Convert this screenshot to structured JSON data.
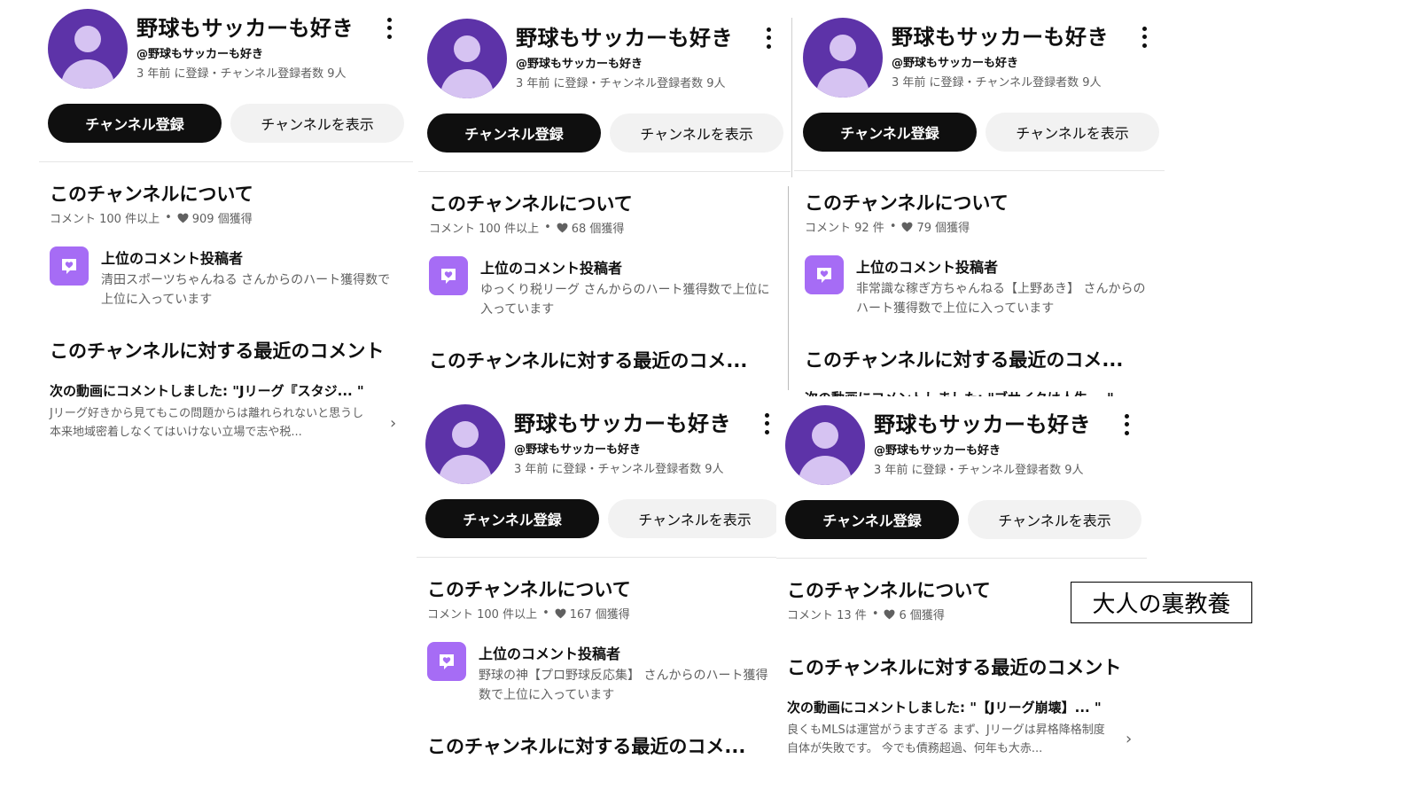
{
  "shared": {
    "channel_name": "野球もサッカーも好き",
    "handle": "@野球もサッカーも好き",
    "meta": "3 年前 に登録・チャンネル登録者数 9人",
    "subscribe_label": "チャンネル登録",
    "view_label": "チャンネルを表示",
    "about_title": "このチャンネルについて",
    "top_commenter_title": "上位のコメント投稿者",
    "recent_title": "このチャンネルに対する最近のコメント",
    "recent_title_truncated": "このチャンネルに対する最近のコメ...",
    "colors": {
      "avatar_bg": "#5d33a8",
      "avatar_figure": "#d6c3f2",
      "badge": "#a66cf5",
      "subscribe_bg": "#0f0f0f",
      "view_bg": "#f2f2f2"
    },
    "icons": [
      "more-vert-icon",
      "heart-icon",
      "comment-heart-icon",
      "chevron-right-icon",
      "avatar-icon"
    ]
  },
  "panels": [
    {
      "comments_count": "コメント 100 件以上",
      "hearts": "909 個獲得",
      "top_commenter_desc": "清田スポーツちゃんねる さんからのハート獲得数で上位に入っています",
      "comment_head": "次の動画にコメントしました: \"Jリーグ『スタジ... \"",
      "comment_text": "Jリーグ好きから見てもこの問題からは離れられないと思うし 本来地域密着しなくてはいけない立場で志や税..."
    },
    {
      "comments_count": "コメント 100 件以上",
      "hearts": "68 個獲得",
      "top_commenter_desc": "ゆっくり税リーグ さんからのハート獲得数で上位に入っています"
    },
    {
      "comments_count": "コメント 92 件",
      "hearts": "79 個獲得",
      "top_commenter_desc": "非常識な稼ぎ方ちゃんねる【上野あき】 さんからのハート獲得数で上位に入っています",
      "comment_head_cut": "次の動画にコメントしました: \"ブサイクは人生... \""
    },
    {
      "comments_count": "コメント 100 件以上",
      "hearts": "167 個獲得",
      "top_commenter_desc": "野球の神【プロ野球反応集】 さんからのハート獲得数で上位に入っています"
    },
    {
      "comments_count": "コメント 13 件",
      "hearts": "6 個獲得",
      "comment_head": "次の動画にコメントしました: \"【Jリーグ崩壊】... \"",
      "comment_text": "良くもMLSは運営がうますぎる まず、Jリーグは昇格降格制度自体が失敗です。 今でも債務超過、何年も大赤..."
    }
  ],
  "annotation": "大人の裏教養"
}
